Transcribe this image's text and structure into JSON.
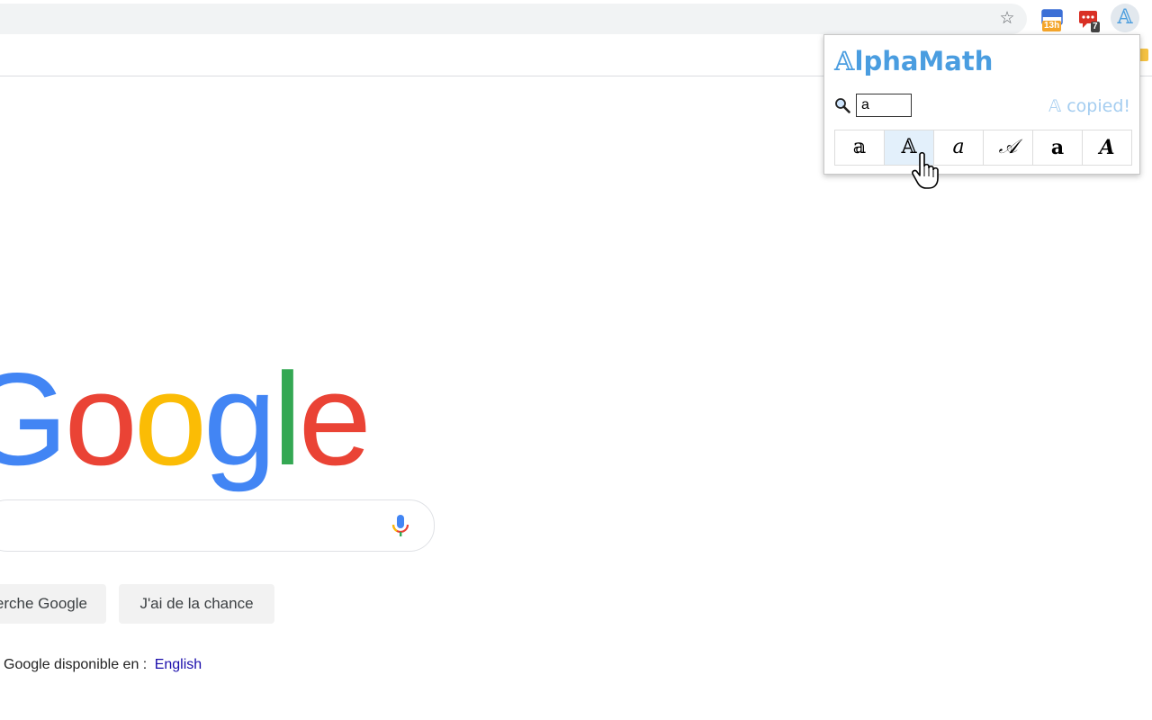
{
  "browser": {
    "star_icon": "star-icon",
    "extensions": [
      {
        "name": "calendar-extension",
        "badge": "13h",
        "badge_color": "#f4a52b"
      },
      {
        "name": "messages-extension",
        "badge": "7",
        "badge_color": "#424242"
      },
      {
        "name": "alphamath-extension",
        "glyph": "𝔸"
      }
    ]
  },
  "popup": {
    "title_prefix": "𝔸",
    "title_rest": "lphaMath",
    "search_value": "a",
    "copied_text": "𝔸 copied!",
    "glyphs": [
      {
        "char": "𝕒",
        "style": "double-struck-lower"
      },
      {
        "char": "𝔸",
        "style": "double-struck",
        "active": true
      },
      {
        "char": "a",
        "style": "italic"
      },
      {
        "char": "𝒜",
        "style": "script"
      },
      {
        "char": "a",
        "style": "bold"
      },
      {
        "char": "A",
        "style": "bold-italic"
      }
    ],
    "accent": "#4a9de0"
  },
  "google": {
    "logo_letters": [
      {
        "char": "G",
        "color": "#4285f4"
      },
      {
        "char": "o",
        "color": "#ea4335"
      },
      {
        "char": "o",
        "color": "#fbbc05"
      },
      {
        "char": "g",
        "color": "#4285f4"
      },
      {
        "char": "l",
        "color": "#34a853"
      },
      {
        "char": "e",
        "color": "#ea4335"
      }
    ],
    "search_button": "erche Google",
    "lucky_button": "J'ai de la chance",
    "lang_prefix": "Google disponible en :",
    "lang_link": "English"
  }
}
